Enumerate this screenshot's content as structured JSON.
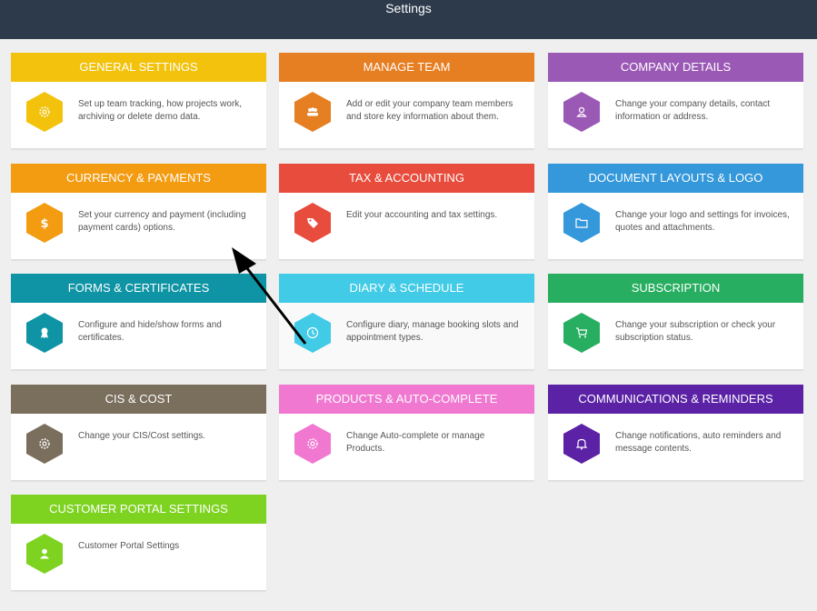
{
  "window": {
    "title": "Settings"
  },
  "cards": [
    {
      "id": "general",
      "title": "GENERAL SETTINGS",
      "desc": "Set up team tracking, how projects work, archiving or delete demo data.",
      "color": "#f2c20c",
      "icon": "gear-icon"
    },
    {
      "id": "team",
      "title": "MANAGE TEAM",
      "desc": "Add or edit your company team members and store key information about them.",
      "color": "#e67e22",
      "icon": "users-icon"
    },
    {
      "id": "company",
      "title": "COMPANY DETAILS",
      "desc": "Change your company details, contact information or address.",
      "color": "#9b59b6",
      "icon": "user-icon"
    },
    {
      "id": "currency",
      "title": "CURRENCY & PAYMENTS",
      "desc": "Set your currency and payment (including payment cards) options.",
      "color": "#f39c12",
      "icon": "dollar-icon"
    },
    {
      "id": "tax",
      "title": "TAX & ACCOUNTING",
      "desc": "Edit your accounting and tax settings.",
      "color": "#e74c3c",
      "icon": "tag-icon"
    },
    {
      "id": "docs",
      "title": "DOCUMENT LAYOUTS & LOGO",
      "desc": "Change your logo and settings for invoices, quotes and attachments.",
      "color": "#3498db",
      "icon": "folder-icon"
    },
    {
      "id": "forms",
      "title": "FORMS & CERTIFICATES",
      "desc": "Configure and hide/show forms and certificates.",
      "color": "#0e94a4",
      "icon": "certificate-icon"
    },
    {
      "id": "diary",
      "title": "DIARY & SCHEDULE",
      "desc": "Configure diary, manage booking slots and appointment types.",
      "color": "#41cbe6",
      "icon": "clock-icon"
    },
    {
      "id": "subscription",
      "title": "SUBSCRIPTION",
      "desc": "Change your subscription or check your subscription status.",
      "color": "#27ae60",
      "icon": "cart-icon"
    },
    {
      "id": "cis",
      "title": "CIS & COST",
      "desc": "Change your CIS/Cost settings.",
      "color": "#7a6e5c",
      "icon": "gear-icon"
    },
    {
      "id": "products",
      "title": "PRODUCTS & AUTO-COMPLETE",
      "desc": "Change Auto-complete or manage Products.",
      "color": "#f078d0",
      "icon": "gear-icon"
    },
    {
      "id": "comms",
      "title": "COMMUNICATIONS & REMINDERS",
      "desc": "Change notifications, auto reminders and message contents.",
      "color": "#5b22a6",
      "icon": "bell-icon"
    },
    {
      "id": "portal",
      "title": "CUSTOMER PORTAL SETTINGS",
      "desc": "Customer Portal Settings",
      "color": "#7ed321",
      "icon": "person-icon"
    }
  ]
}
